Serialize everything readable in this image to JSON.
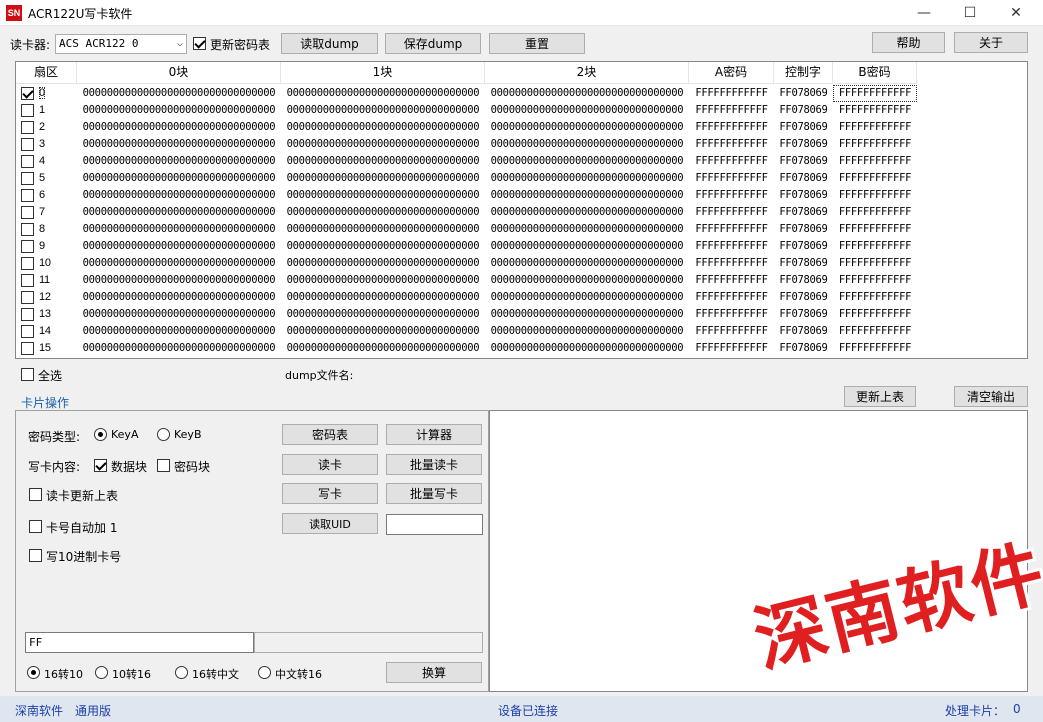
{
  "window": {
    "icon_text": "SN",
    "title": "ACR122U写卡软件",
    "minimize": "—",
    "maximize": "☐",
    "close": "✕"
  },
  "toolbar": {
    "reader_label": "读卡器:",
    "reader_value": "ACS ACR122 0",
    "update_key_table": "更新密码表",
    "read_dump": "读取dump",
    "save_dump": "保存dump",
    "reset": "重置",
    "help": "帮助",
    "about": "关于"
  },
  "grid": {
    "headers": [
      "扇区",
      "0块",
      "1块",
      "2块",
      "A密码",
      "控制字",
      "B密码"
    ],
    "rows": [
      {
        "sector": "0",
        "checked": true,
        "b0": "00000000000000000000000000000000",
        "b1": "00000000000000000000000000000000",
        "b2": "00000000000000000000000000000000",
        "keya": "FFFFFFFFFFFF",
        "ctrl": "FF078069",
        "keyb": "FFFFFFFFFFFF"
      },
      {
        "sector": "1",
        "checked": false,
        "b0": "00000000000000000000000000000000",
        "b1": "00000000000000000000000000000000",
        "b2": "00000000000000000000000000000000",
        "keya": "FFFFFFFFFFFF",
        "ctrl": "FF078069",
        "keyb": "FFFFFFFFFFFF"
      },
      {
        "sector": "2",
        "checked": false,
        "b0": "00000000000000000000000000000000",
        "b1": "00000000000000000000000000000000",
        "b2": "00000000000000000000000000000000",
        "keya": "FFFFFFFFFFFF",
        "ctrl": "FF078069",
        "keyb": "FFFFFFFFFFFF"
      },
      {
        "sector": "3",
        "checked": false,
        "b0": "00000000000000000000000000000000",
        "b1": "00000000000000000000000000000000",
        "b2": "00000000000000000000000000000000",
        "keya": "FFFFFFFFFFFF",
        "ctrl": "FF078069",
        "keyb": "FFFFFFFFFFFF"
      },
      {
        "sector": "4",
        "checked": false,
        "b0": "00000000000000000000000000000000",
        "b1": "00000000000000000000000000000000",
        "b2": "00000000000000000000000000000000",
        "keya": "FFFFFFFFFFFF",
        "ctrl": "FF078069",
        "keyb": "FFFFFFFFFFFF"
      },
      {
        "sector": "5",
        "checked": false,
        "b0": "00000000000000000000000000000000",
        "b1": "00000000000000000000000000000000",
        "b2": "00000000000000000000000000000000",
        "keya": "FFFFFFFFFFFF",
        "ctrl": "FF078069",
        "keyb": "FFFFFFFFFFFF"
      },
      {
        "sector": "6",
        "checked": false,
        "b0": "00000000000000000000000000000000",
        "b1": "00000000000000000000000000000000",
        "b2": "00000000000000000000000000000000",
        "keya": "FFFFFFFFFFFF",
        "ctrl": "FF078069",
        "keyb": "FFFFFFFFFFFF"
      },
      {
        "sector": "7",
        "checked": false,
        "b0": "00000000000000000000000000000000",
        "b1": "00000000000000000000000000000000",
        "b2": "00000000000000000000000000000000",
        "keya": "FFFFFFFFFFFF",
        "ctrl": "FF078069",
        "keyb": "FFFFFFFFFFFF"
      },
      {
        "sector": "8",
        "checked": false,
        "b0": "00000000000000000000000000000000",
        "b1": "00000000000000000000000000000000",
        "b2": "00000000000000000000000000000000",
        "keya": "FFFFFFFFFFFF",
        "ctrl": "FF078069",
        "keyb": "FFFFFFFFFFFF"
      },
      {
        "sector": "9",
        "checked": false,
        "b0": "00000000000000000000000000000000",
        "b1": "00000000000000000000000000000000",
        "b2": "00000000000000000000000000000000",
        "keya": "FFFFFFFFFFFF",
        "ctrl": "FF078069",
        "keyb": "FFFFFFFFFFFF"
      },
      {
        "sector": "10",
        "checked": false,
        "b0": "00000000000000000000000000000000",
        "b1": "00000000000000000000000000000000",
        "b2": "00000000000000000000000000000000",
        "keya": "FFFFFFFFFFFF",
        "ctrl": "FF078069",
        "keyb": "FFFFFFFFFFFF"
      },
      {
        "sector": "11",
        "checked": false,
        "b0": "00000000000000000000000000000000",
        "b1": "00000000000000000000000000000000",
        "b2": "00000000000000000000000000000000",
        "keya": "FFFFFFFFFFFF",
        "ctrl": "FF078069",
        "keyb": "FFFFFFFFFFFF"
      },
      {
        "sector": "12",
        "checked": false,
        "b0": "00000000000000000000000000000000",
        "b1": "00000000000000000000000000000000",
        "b2": "00000000000000000000000000000000",
        "keya": "FFFFFFFFFFFF",
        "ctrl": "FF078069",
        "keyb": "FFFFFFFFFFFF"
      },
      {
        "sector": "13",
        "checked": false,
        "b0": "00000000000000000000000000000000",
        "b1": "00000000000000000000000000000000",
        "b2": "00000000000000000000000000000000",
        "keya": "FFFFFFFFFFFF",
        "ctrl": "FF078069",
        "keyb": "FFFFFFFFFFFF"
      },
      {
        "sector": "14",
        "checked": false,
        "b0": "00000000000000000000000000000000",
        "b1": "00000000000000000000000000000000",
        "b2": "00000000000000000000000000000000",
        "keya": "FFFFFFFFFFFF",
        "ctrl": "FF078069",
        "keyb": "FFFFFFFFFFFF"
      },
      {
        "sector": "15",
        "checked": false,
        "b0": "00000000000000000000000000000000",
        "b1": "00000000000000000000000000000000",
        "b2": "00000000000000000000000000000000",
        "keya": "FFFFFFFFFFFF",
        "ctrl": "FF078069",
        "keyb": "FFFFFFFFFFFF"
      }
    ]
  },
  "below_grid": {
    "select_all": "全选",
    "dump_filename_label": "dump文件名:",
    "section_label": "卡片操作",
    "update_table": "更新上表",
    "clear_output": "清空输出"
  },
  "card_ops": {
    "key_type_label": "密码类型:",
    "key_a": "KeyA",
    "key_b": "KeyB",
    "write_content_label": "写卡内容:",
    "data_block": "数据块",
    "key_block": "密码块",
    "read_update_table": "读卡更新上表",
    "auto_increment": "卡号自动加 1",
    "write_decimal": "写10进制卡号",
    "key_table_btn": "密码表",
    "calculator_btn": "计算器",
    "read_card_btn": "读卡",
    "batch_read_btn": "批量读卡",
    "write_card_btn": "写卡",
    "batch_write_btn": "批量写卡",
    "read_uid_btn": "读取UID",
    "uid_value": "",
    "convert_input": "FF",
    "convert_output": "",
    "hex_to_dec": "16转10",
    "dec_to_hex": "10转16",
    "hex_to_cn": "16转中文",
    "cn_to_hex": "中文转16",
    "convert_btn": "换算"
  },
  "status": {
    "brand": "深南软件",
    "edition": "通用版",
    "device_status": "设备已连接",
    "processed_label": "处理卡片：",
    "processed_count": "0"
  },
  "watermark": "深南软件"
}
